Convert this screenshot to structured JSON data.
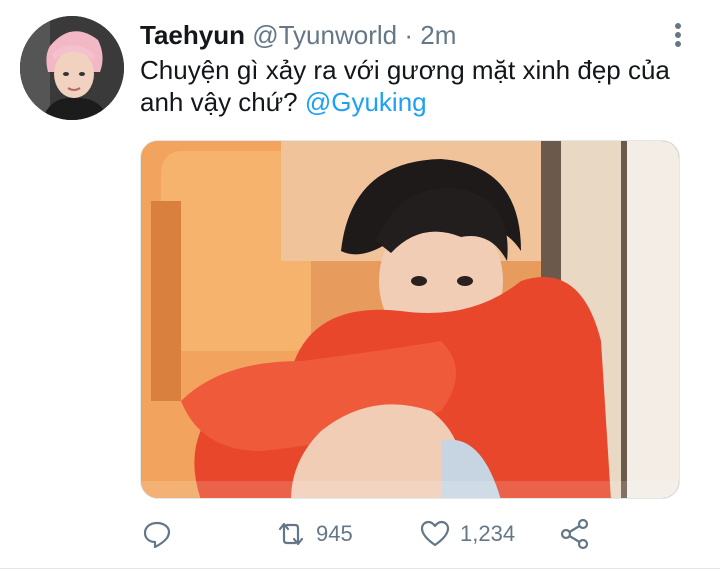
{
  "tweet": {
    "author_name": "Taehyun",
    "author_handle": "@Tyunworld",
    "separator": "·",
    "time": "2m",
    "text": "Chuyện gì xảy ra với gương mặt xinh đẹp của anh vậy chứ?",
    "mention": "@Gyuking"
  },
  "actions": {
    "reply_icon": "reply-icon",
    "retweet_icon": "retweet-icon",
    "retweet_count": "945",
    "like_icon": "heart-icon",
    "like_count": "1,234",
    "share_icon": "share-icon"
  },
  "colors": {
    "mention": "#1da1f2",
    "muted": "#657786",
    "text": "#14171a",
    "photo_background": "#e8a36a",
    "sweater": "#e8472c"
  }
}
